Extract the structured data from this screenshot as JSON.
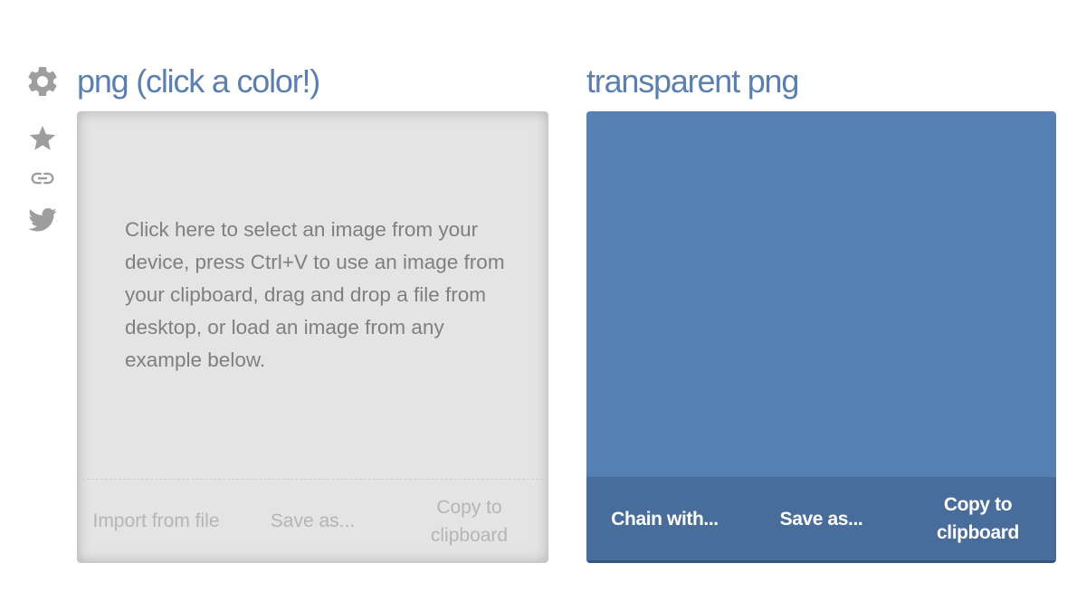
{
  "colors": {
    "accent": "#5680b4",
    "title": "#5b7fae",
    "icon": "#9e9e9e",
    "output_canvas": "#5580b3",
    "output_actions_bg": "#486d9b",
    "output_bottom_line": "#34557f"
  },
  "sidebar": {
    "icons": [
      {
        "name": "gear-icon"
      },
      {
        "name": "star-icon"
      },
      {
        "name": "link-icon"
      },
      {
        "name": "twitter-icon"
      }
    ]
  },
  "input_panel": {
    "title": "png (click a color!)",
    "drop_text": "Click here to select an image from your device, press Ctrl+V to use an image from your clipboard, drag and drop a file from desktop, or load an image from any example below.",
    "actions": {
      "import": "Import from file",
      "save": "Save as...",
      "copy_line1": "Copy to",
      "copy_line2": "clipboard"
    }
  },
  "output_panel": {
    "title": "transparent png",
    "actions": {
      "chain": "Chain with...",
      "save": "Save as...",
      "copy_line1": "Copy to",
      "copy_line2": "clipboard"
    }
  }
}
